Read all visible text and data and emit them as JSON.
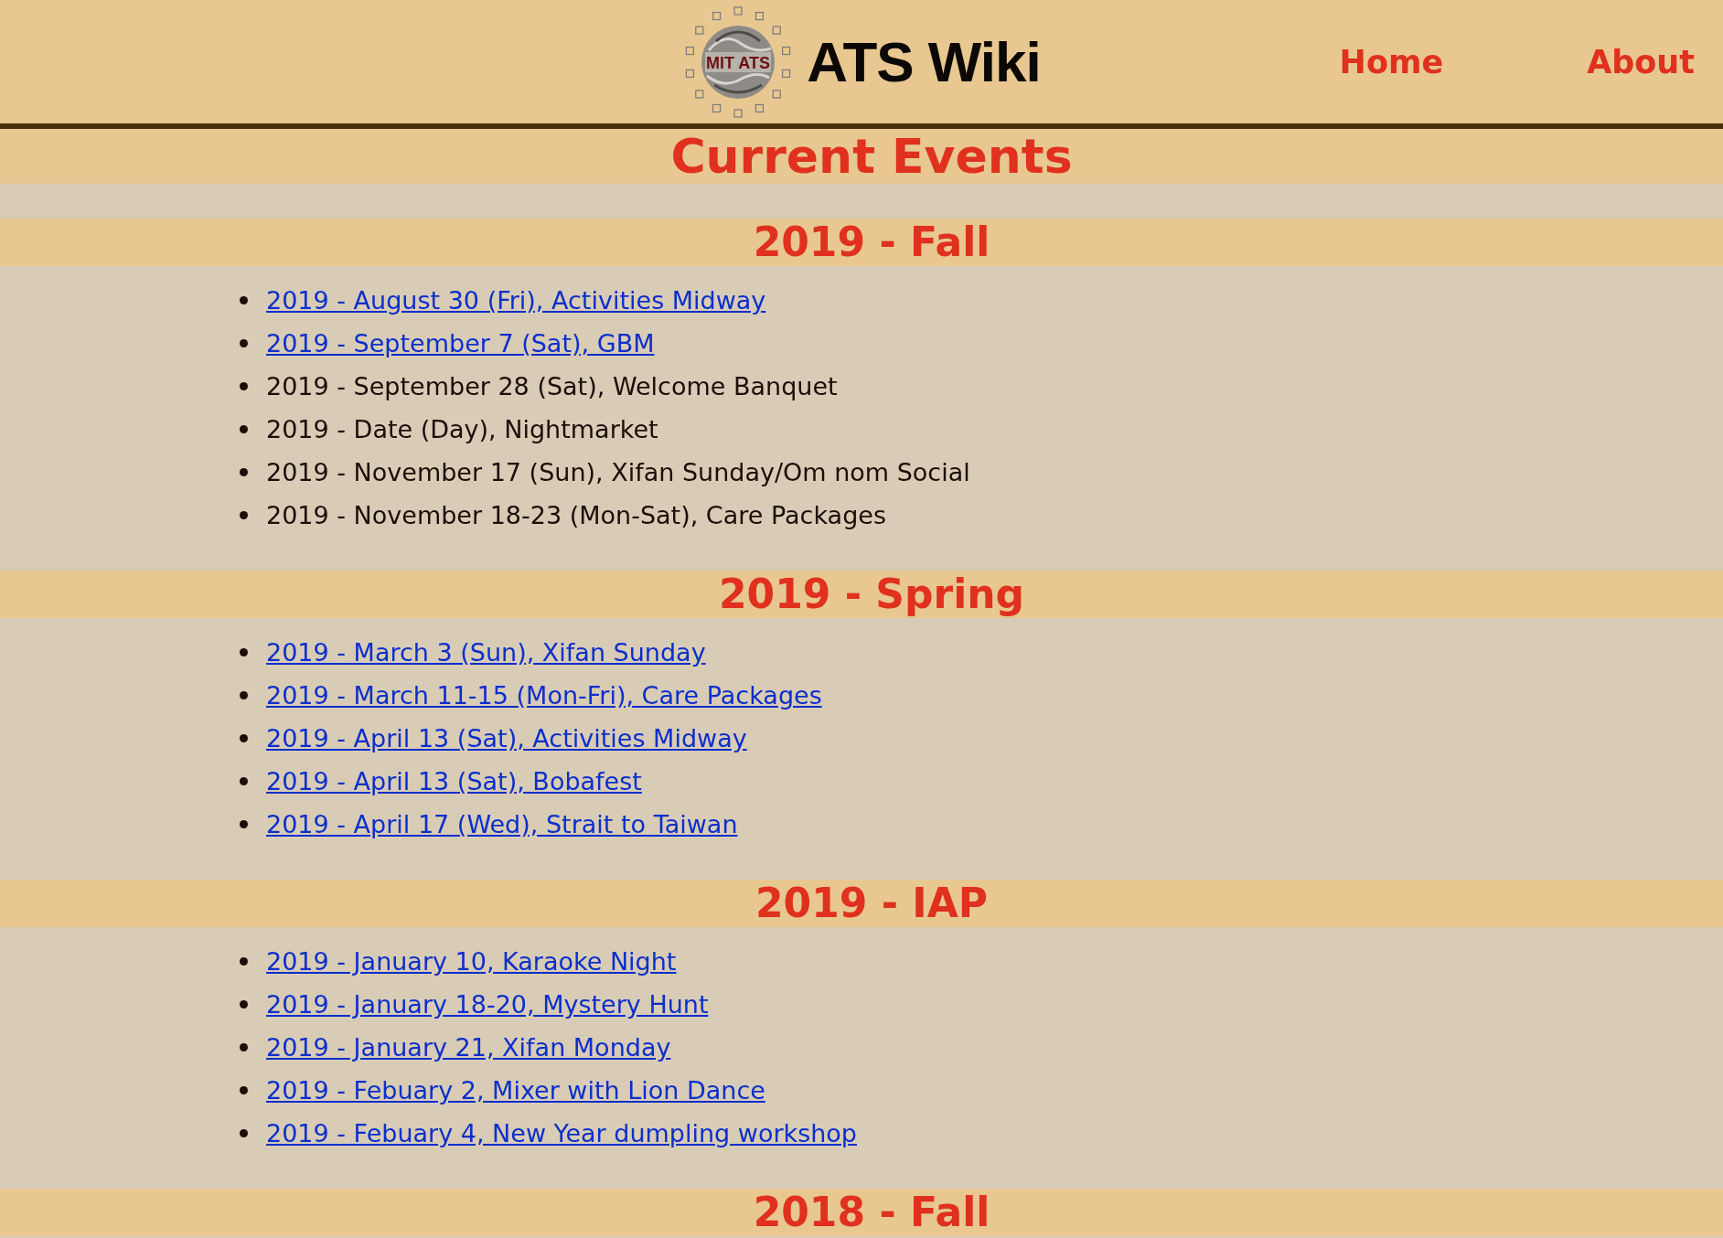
{
  "header": {
    "logo_text": "MIT ATS",
    "site_title": "ATS Wiki",
    "nav": [
      "Home",
      "About"
    ]
  },
  "page_title": "Current Events",
  "sections": [
    {
      "heading": "2019 - Fall",
      "items": [
        {
          "kind": "link",
          "text": "2019 - August 30 (Fri), Activities Midway"
        },
        {
          "kind": "link",
          "text": "2019 - September 7 (Sat), GBM"
        },
        {
          "kind": "text",
          "text": "2019 - September 28 (Sat), Welcome Banquet"
        },
        {
          "kind": "text",
          "text": "2019 - Date (Day), Nightmarket"
        },
        {
          "kind": "text",
          "text": "2019 - November 17 (Sun), Xifan Sunday/Om nom Social"
        },
        {
          "kind": "text",
          "text": "2019 - November 18-23 (Mon-Sat), Care Packages"
        }
      ]
    },
    {
      "heading": "2019 - Spring",
      "items": [
        {
          "kind": "link",
          "text": "2019 - March 3 (Sun), Xifan Sunday"
        },
        {
          "kind": "link",
          "text": "2019 - March 11-15 (Mon-Fri), Care Packages"
        },
        {
          "kind": "link",
          "text": "2019 - April 13 (Sat), Activities Midway"
        },
        {
          "kind": "link",
          "text": "2019 - April 13 (Sat), Bobafest"
        },
        {
          "kind": "link",
          "text": "2019 - April 17 (Wed), Strait to Taiwan"
        }
      ]
    },
    {
      "heading": "2019 - IAP",
      "items": [
        {
          "kind": "link",
          "text": "2019 - January 10, Karaoke Night"
        },
        {
          "kind": "link",
          "text": "2019 - January 18-20, Mystery Hunt"
        },
        {
          "kind": "link",
          "text": "2019 - January 21, Xifan Monday"
        },
        {
          "kind": "link",
          "text": "2019 - Febuary 2, Mixer with Lion Dance"
        },
        {
          "kind": "link",
          "text": "2019 - Febuary 4, New Year dumpling workshop"
        }
      ]
    },
    {
      "heading": "2018 - Fall"
    }
  ]
}
